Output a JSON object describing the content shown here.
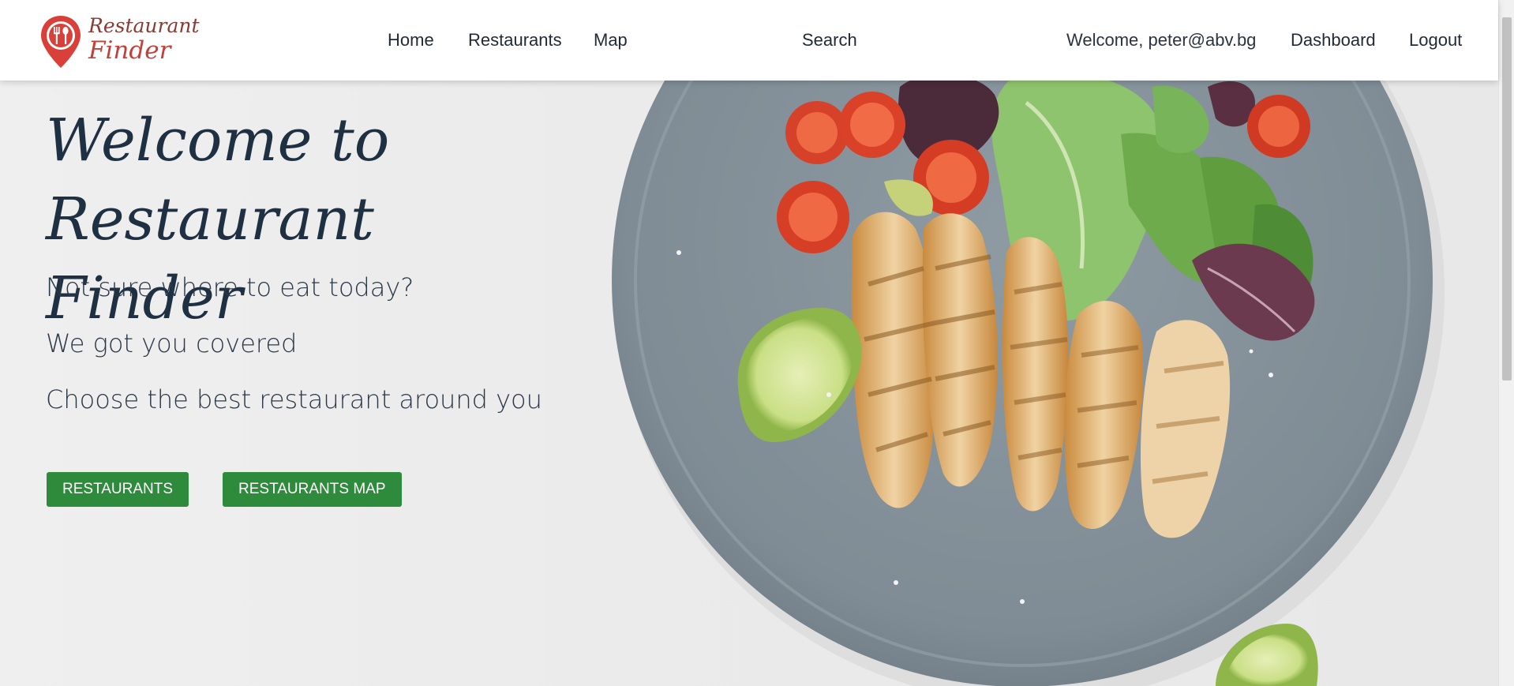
{
  "logo": {
    "line1": "Restaurant",
    "line2": "Finder",
    "icon": "map-pin-fork-spoon-icon",
    "color": "#d9403a"
  },
  "nav": {
    "home": "Home",
    "restaurants": "Restaurants",
    "map": "Map",
    "search": "Search",
    "welcome": "Welcome, peter@abv.bg",
    "dashboard": "Dashboard",
    "logout": "Logout"
  },
  "hero": {
    "title_line1": "Welcome to",
    "title_line2": "Restaurant Finder",
    "taglines": [
      "Not sure where to eat today?",
      "We got you covered",
      "Choose the best restaurant around you"
    ],
    "buttons": {
      "restaurants": "RESTAURANTS",
      "restaurants_map": "RESTAURANTS MAP"
    },
    "button_color": "#2e8b3c",
    "image": "grilled-chicken-salad-plate"
  }
}
